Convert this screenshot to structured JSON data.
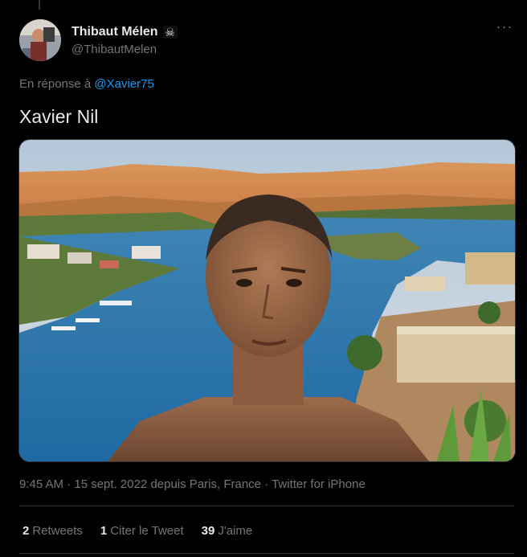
{
  "tweet": {
    "author": {
      "display_name": "Thibaut Mélen",
      "badge_emoji": "☠",
      "handle": "@ThibautMelen"
    },
    "more_icon": "more-dots-icon",
    "reply_prefix": "En réponse à",
    "reply_handle": "@Xavier75",
    "text": "Xavier Nil",
    "timestamp": "9:45 AM · 15 sept. 2022 depuis Paris, France · Twitter for iPhone",
    "stats": {
      "retweets_count": "2",
      "retweets_label": "Retweets",
      "quotes_count": "1",
      "quotes_label": "Citer le Tweet",
      "likes_count": "39",
      "likes_label": "J'aime"
    }
  },
  "colors": {
    "background": "#000000",
    "text": "#e7e9ea",
    "muted": "#71767b",
    "link": "#1d9bf0",
    "divider": "#2f3336"
  }
}
